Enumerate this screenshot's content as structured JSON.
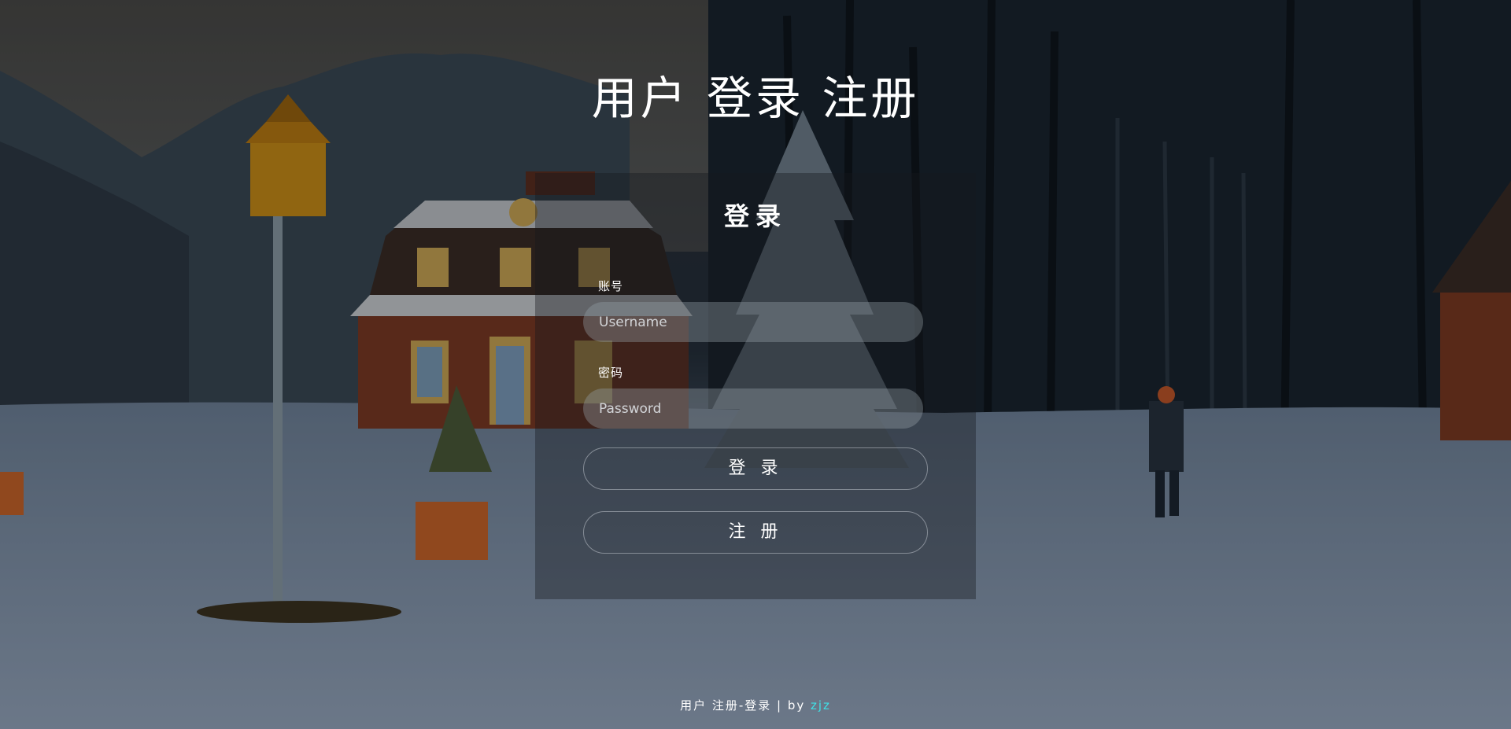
{
  "page": {
    "title": "用户 登录 注册"
  },
  "login_form": {
    "heading": "登录",
    "username": {
      "label": "账号",
      "placeholder": "Username",
      "value": ""
    },
    "password": {
      "label": "密码",
      "placeholder": "Password",
      "value": ""
    },
    "login_button": "登 录",
    "register_button": "注 册"
  },
  "footer": {
    "text": "用户 注册-登录 | by ",
    "author": "zjz"
  },
  "colors": {
    "text": "#ffffff",
    "author_link": "#3fe0e6"
  }
}
